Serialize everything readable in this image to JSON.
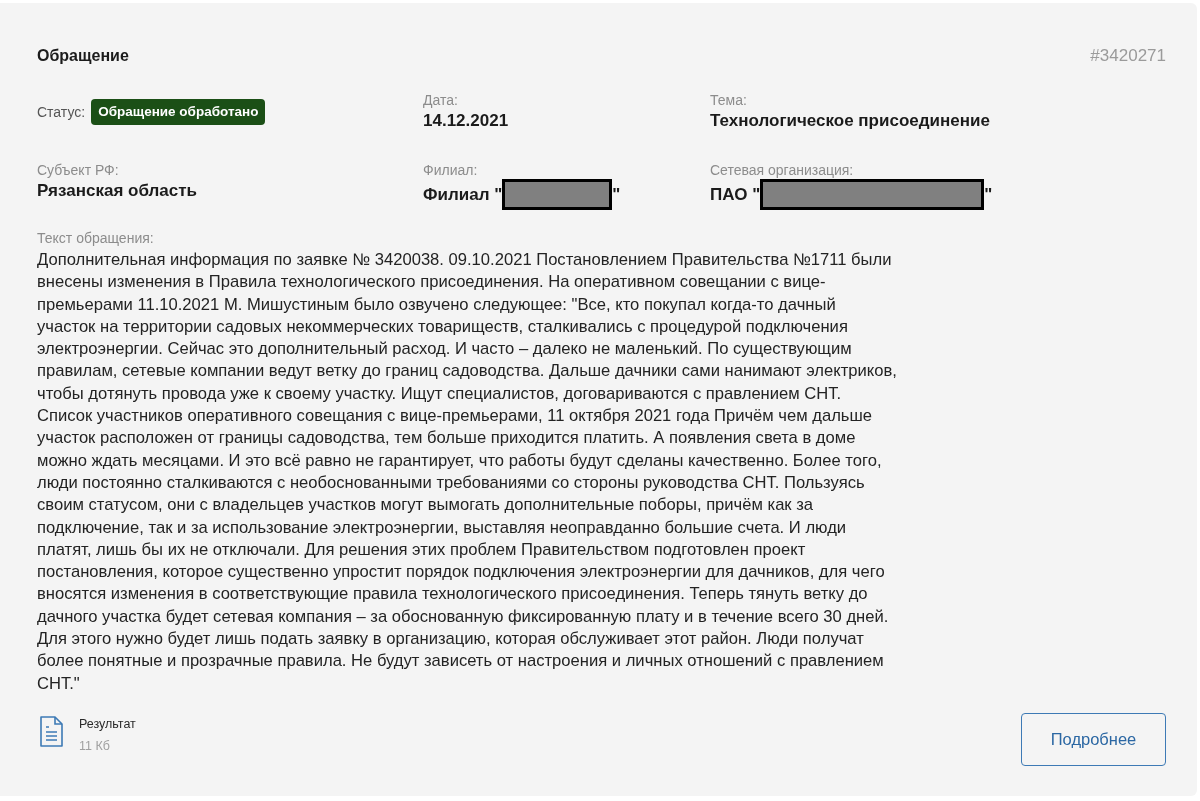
{
  "card": {
    "title": "Обращение",
    "number": "#3420271"
  },
  "fields": [
    {
      "kind": "status",
      "label": "Статус:",
      "value": "Обращение обработано"
    },
    {
      "kind": "text",
      "label": "Дата:",
      "value": "14.12.2021"
    },
    {
      "kind": "text",
      "label": "Тема:",
      "value": "Технологическое присоединение"
    },
    {
      "kind": "text",
      "label": "Субъект РФ:",
      "value": "Рязанская область"
    },
    {
      "kind": "redacted",
      "label": "Филиал:",
      "value_start": "Филиал \"",
      "value_end": "\""
    },
    {
      "kind": "redacted",
      "label": "Сетевая организация:",
      "value_start": "ПАО \"",
      "value_end": "\""
    }
  ],
  "message": {
    "label": "Текст обращения:",
    "text": "Дополнительная информация по заявке № 3420038. 09.10.2021 Постановлением Правительства №1711 были внесены изменения в Правила технологического присоединения. На оперативном совещании с вице-премьерами 11.10.2021 М. Мишустиным было озвучено следующее: \"Все, кто покупал когда-то дачный участок на территории садовых некоммерческих товариществ, сталкивались с процедурой подключения электроэнергии. Сейчас это дополнительный расход. И часто – далеко не маленький. По существующим правилам, сетевые компании ведут ветку до границ садоводства. Дальше дачники сами нанимают электриков, чтобы дотянуть провода уже к своему участку. Ищут специалистов, договариваются с правлением СНТ. Список участников оперативного совещания с вице-премьерами, 11 октября 2021 года Причём чем дальше участок расположен от границы садоводства, тем больше приходится платить. А появления света в доме можно ждать месяцами. И это всё равно не гарантирует, что работы будут сделаны качественно. Более того, люди постоянно сталкиваются с необоснованными требованиями со стороны руководства СНТ. Пользуясь своим статусом, они с владельцев участков могут вымогать дополнительные поборы, причём как за подключение, так и за использование электроэнергии, выставляя неоправданно большие счета. И люди платят, лишь бы их не отключали. Для решения этих проблем Правительством подготовлен проект постановления, которое существенно упростит порядок подключения электроэнергии для дачников, для чего вносятся изменения в соответствующие правила технологического присоединения. Теперь тянуть ветку до дачного участка будет сетевая компания – за обоснованную фиксированную плату и в течение всего 30 дней. Для этого нужно будет лишь подать заявку в организацию, которая обслуживает этот район. Люди получат более понятные и прозрачные правила. Не будут зависеть от настроения и личных отношений с правлением СНТ.\""
  },
  "attachment": {
    "name": "Результат",
    "size": "11 Кб"
  },
  "button": {
    "label": "Подробнее"
  }
}
